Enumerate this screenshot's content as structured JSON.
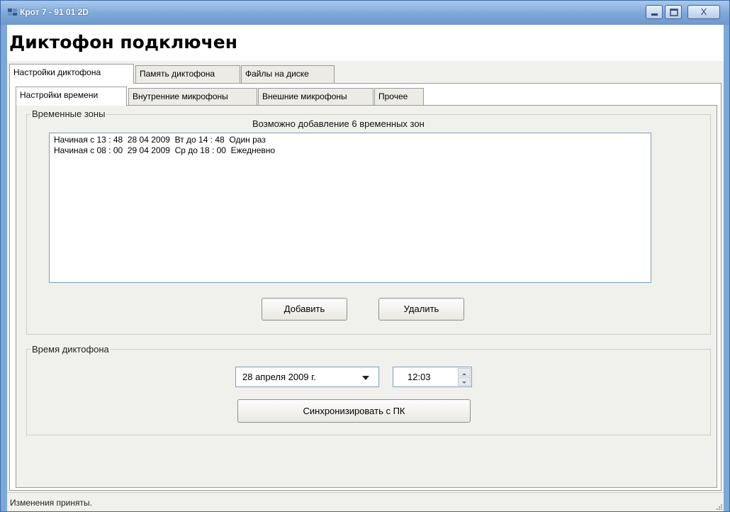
{
  "window": {
    "title": "Крот 7 - 91 01 2D",
    "controls": [
      "minimize",
      "maximize",
      "close"
    ],
    "close_label": "X"
  },
  "header": {
    "title": "Диктофон подключен"
  },
  "main_tabs": [
    {
      "label": "Настройки диктофона",
      "active": true
    },
    {
      "label": "Память диктофона",
      "active": false
    },
    {
      "label": "Файлы на диске",
      "active": false
    }
  ],
  "sub_tabs": [
    {
      "label": "Настройки времени",
      "active": true
    },
    {
      "label": "Внутренние микрофоны",
      "active": false
    },
    {
      "label": "Внешние микрофоны",
      "active": false
    },
    {
      "label": "Прочее",
      "active": false
    }
  ],
  "time_zones": {
    "group_label": "Временные зоны",
    "info": "Возможно добавление 6 временных зон",
    "items": [
      "Начиная с 13 : 48  28 04 2009  Вт до 14 : 48  Один раз",
      "Начиная с 08 : 00  29 04 2009  Ср до 18 : 00  Ежедневно"
    ],
    "add_button": "Добавить",
    "delete_button": "Удалить"
  },
  "recorder_time": {
    "group_label": "Время диктофона",
    "date_value": "28  апреля  2009 г.",
    "time_value": "12:03",
    "sync_button": "Синхронизировать с ПК"
  },
  "status": {
    "text": "Изменения приняты."
  },
  "colors": {
    "titlebar": "#7da7d9",
    "window_background": "#f0f0ec",
    "content_background": "#ffffff"
  }
}
